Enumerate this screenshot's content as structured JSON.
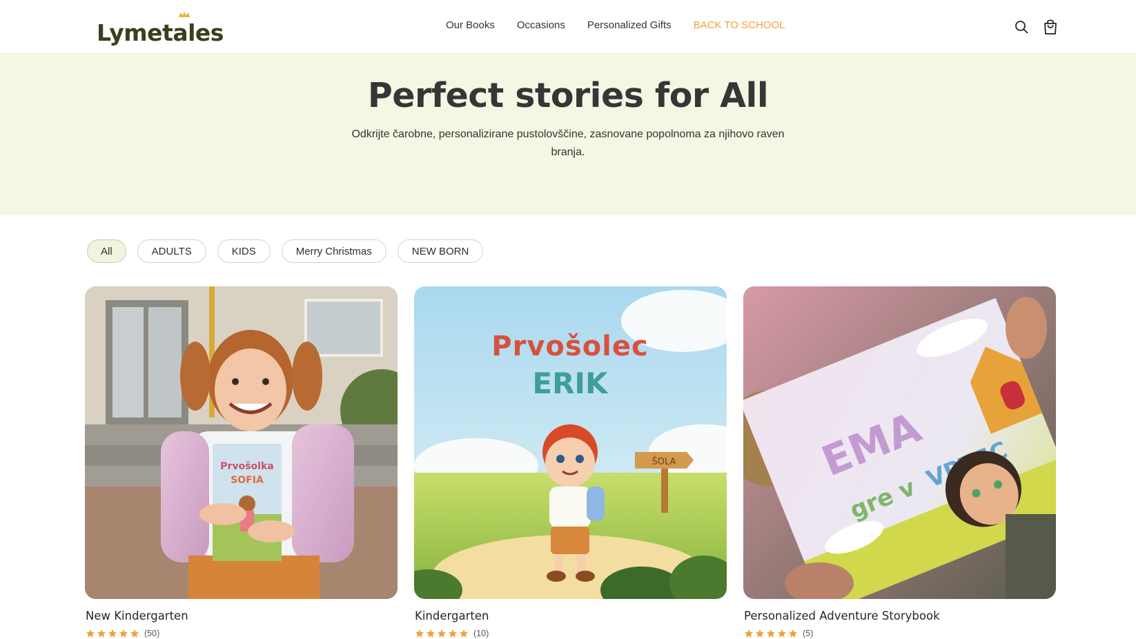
{
  "brand": {
    "name": "Lymetales",
    "accent_color": "#f0a23a",
    "logo_color": "#3b3f1d"
  },
  "nav": {
    "items": [
      {
        "label": "Our Books"
      },
      {
        "label": "Occasions"
      },
      {
        "label": "Personalized Gifts"
      },
      {
        "label": "BACK TO SCHOOL"
      }
    ]
  },
  "header_icons": [
    "search-icon",
    "cart-icon"
  ],
  "hero": {
    "title": "Perfect stories for All",
    "subtitle": "Odkrijte čarobne, personalizirane pustolovščine, zasnovane popolnoma za njihovo raven branja.",
    "background": "#f4f7e3"
  },
  "filters": {
    "selected": "All",
    "items": [
      {
        "label": "All"
      },
      {
        "label": "ADULTS"
      },
      {
        "label": "KIDS"
      },
      {
        "label": "Merry Christmas"
      },
      {
        "label": "NEW BORN"
      }
    ]
  },
  "products": [
    {
      "title": "New Kindergarten",
      "rating": 5,
      "review_count": "(50)",
      "cover_text": [
        "Prvošolka",
        "SOFIA"
      ]
    },
    {
      "title": "Kindergarten",
      "rating": 5,
      "review_count": "(10)",
      "cover_text": [
        "Prvošolec",
        "ERIK",
        "ŠOLA"
      ]
    },
    {
      "title": "Personalized Adventure Storybook",
      "rating": 5,
      "review_count": "(5)",
      "cover_text": [
        "EMA",
        "gre v VRTEC"
      ]
    }
  ],
  "star_color": "#f0a23a"
}
